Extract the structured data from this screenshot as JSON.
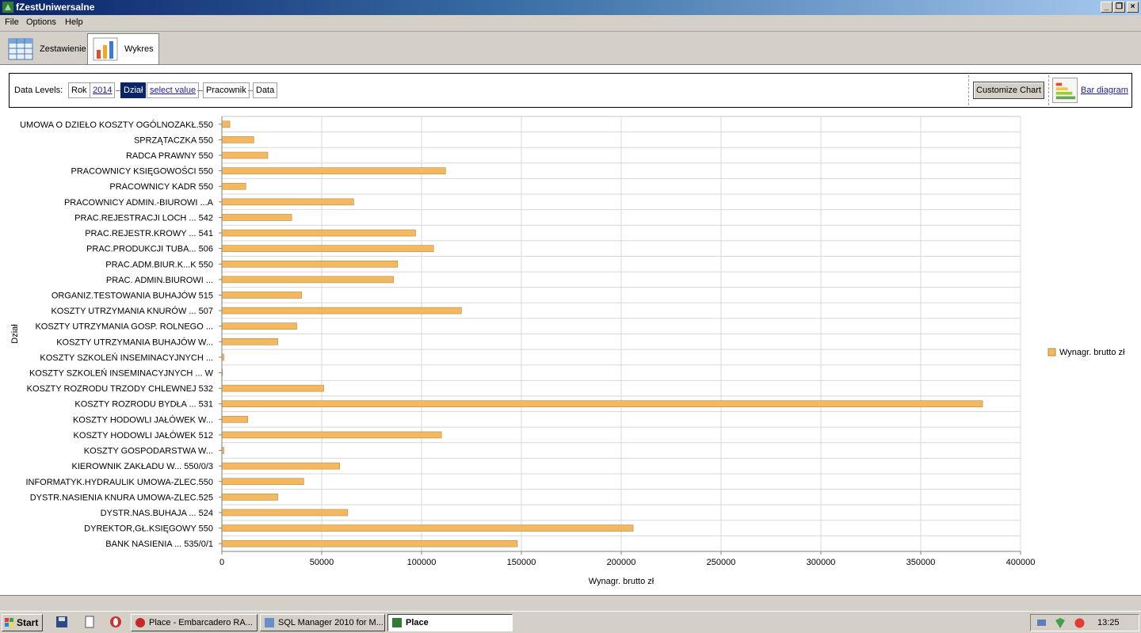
{
  "window": {
    "title": "fZestUniwersalne"
  },
  "menu": [
    "File",
    "Options",
    "Help"
  ],
  "tabs": [
    {
      "label": "Zestawienie",
      "icon": "table-icon"
    },
    {
      "label": "Wykres",
      "icon": "bar-chart-icon"
    }
  ],
  "levels": {
    "label": "Data Levels:",
    "rok": "Rok",
    "rok_value": "2014",
    "dzial": "Dział",
    "dzial_value": "select value",
    "pracownik": "Pracownik",
    "data": "Data"
  },
  "toolbar": {
    "customize": "Customize Chart",
    "bar_diagram": "Bar diagram"
  },
  "chart_data": {
    "type": "bar",
    "orientation": "horizontal",
    "xlabel": "Wynagr. brutto zł",
    "ylabel": "Dział",
    "xlim": [
      0,
      400000
    ],
    "xticks": [
      "0",
      "50000",
      "100000",
      "150000",
      "200000",
      "250000",
      "300000",
      "350000",
      "400000"
    ],
    "grid": true,
    "legend": "right",
    "bar_color": "#f4b860",
    "series": [
      {
        "name": "Wynagr. brutto zł",
        "categories": [
          "UMOWA O DZIEŁO KOSZTY OGÓLNOZAKŁ.550",
          "SPRZĄTACZKA 550",
          "RADCA PRAWNY 550",
          "PRACOWNICY KSIĘGOWOŚCI 550",
          "PRACOWNICY KADR 550",
          "PRACOWNICY ADMIN.-BIUROWI ...A",
          "PRAC.REJESTRACJI LOCH ... 542",
          "PRAC.REJESTR.KROWY ... 541",
          "PRAC.PRODUKCJI TUBA... 506",
          "PRAC.ADM.BIUR.K...K 550",
          "PRAC. ADMIN.BIUROWI ...",
          "ORGANIZ.TESTOWANIA BUHAJÓW 515",
          "KOSZTY UTRZYMANIA KNURÓW ... 507",
          "KOSZTY UTRZYMANIA GOSP. ROLNEGO ...",
          "KOSZTY UTRZYMANIA  BUHAJÓW W...",
          "KOSZTY SZKOLEŃ INSEMINACYJNYCH ...",
          "KOSZTY SZKOLEŃ INSEMINACYJNYCH ... W",
          "KOSZTY ROZRODU TRZODY CHLEWNEJ 532",
          "KOSZTY ROZRODU BYDŁA ... 531",
          "KOSZTY HODOWLI JAŁÓWEK W...",
          "KOSZTY HODOWLI JAŁÓWEK 512",
          "KOSZTY GOSPODARSTWA W...",
          "KIEROWNIK ZAKŁADU W... 550/0/3",
          "INFORMATYK.HYDRAULIK UMOWA-ZLEC.550",
          "DYSTR.NASIENIA KNURA UMOWA-ZLEC.525",
          "DYSTR.NAS.BUHAJA ... 524",
          "DYREKTOR,GŁ.KSIĘGOWY 550",
          "BANK NASIENIA ... 535/0/1"
        ],
        "values": [
          4000,
          16000,
          23000,
          112000,
          12000,
          66000,
          35000,
          97000,
          106000,
          88000,
          86000,
          40000,
          120000,
          37500,
          28000,
          1000,
          300,
          51000,
          381000,
          13000,
          110000,
          1000,
          59000,
          41000,
          28000,
          63000,
          206000,
          148000
        ]
      }
    ]
  }
}
